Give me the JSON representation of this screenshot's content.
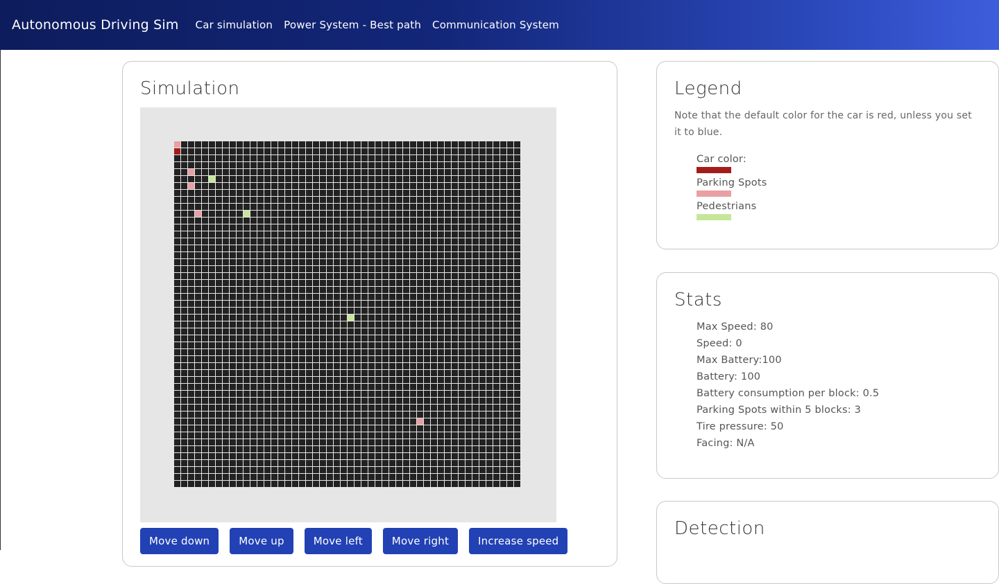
{
  "navbar": {
    "brand": "Autonomous Driving Sim",
    "links": [
      "Car simulation",
      "Power System - Best path",
      "Communication System"
    ]
  },
  "simulation": {
    "title": "Simulation",
    "grid": {
      "cols": 50,
      "rows": 50,
      "cells": [
        {
          "col": 0,
          "row": 0,
          "type": "park"
        },
        {
          "col": 0,
          "row": 1,
          "type": "car"
        },
        {
          "col": 2,
          "row": 4,
          "type": "park"
        },
        {
          "col": 5,
          "row": 5,
          "type": "ped"
        },
        {
          "col": 2,
          "row": 6,
          "type": "park"
        },
        {
          "col": 3,
          "row": 10,
          "type": "park"
        },
        {
          "col": 10,
          "row": 10,
          "type": "ped"
        },
        {
          "col": 25,
          "row": 25,
          "type": "ped"
        },
        {
          "col": 35,
          "row": 40,
          "type": "park"
        }
      ]
    },
    "buttons": [
      "Move down",
      "Move up",
      "Move left",
      "Move right",
      "Increase speed"
    ]
  },
  "legend": {
    "title": "Legend",
    "note": "Note that the default color for the car is red, unless you set it to blue.",
    "items": [
      {
        "label": "Car color:",
        "color": "#a31c1c"
      },
      {
        "label": "Parking Spots",
        "color": "#e8a0a4"
      },
      {
        "label": "Pedestrians",
        "color": "#c6e79a"
      }
    ]
  },
  "stats": {
    "title": "Stats",
    "items": [
      "Max Speed: 80",
      "Speed: 0",
      "Max Battery:100",
      "Battery: 100",
      "Battery consumption per block: 0.5",
      "Parking Spots within 5 blocks: 3",
      "Tire pressure: 50",
      "Facing: N/A"
    ]
  },
  "detection": {
    "title": "Detection"
  },
  "colors": {
    "navbar_start": "#0d1c5c",
    "navbar_end": "#3d5ddc",
    "button": "#2141b5",
    "grid_cell": "#222222"
  }
}
